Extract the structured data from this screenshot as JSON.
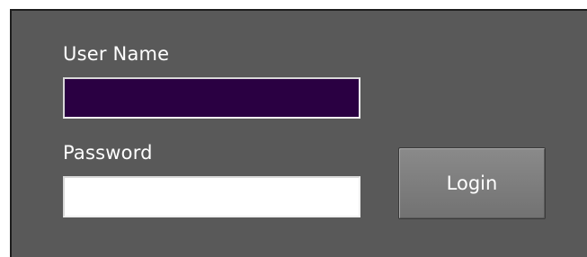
{
  "login_form": {
    "username_label": "User Name",
    "username_value": "",
    "password_label": "Password",
    "password_value": "",
    "login_button_label": "Login"
  },
  "colors": {
    "panel_background": "#595959",
    "username_field_background": "#2a0042",
    "password_field_background": "#ffffff",
    "button_background": "#7d7d7d",
    "text": "#ffffff"
  }
}
